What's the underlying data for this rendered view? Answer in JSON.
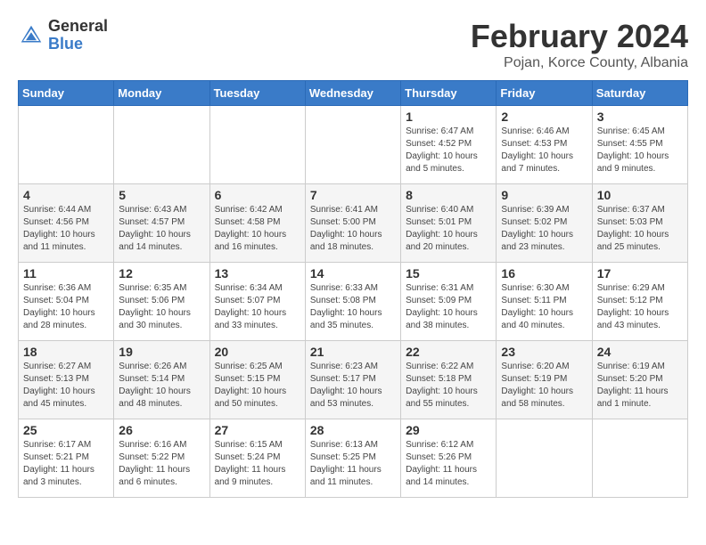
{
  "header": {
    "logo_general": "General",
    "logo_blue": "Blue",
    "title": "February 2024",
    "subtitle": "Pojan, Korce County, Albania"
  },
  "days_of_week": [
    "Sunday",
    "Monday",
    "Tuesday",
    "Wednesday",
    "Thursday",
    "Friday",
    "Saturday"
  ],
  "weeks": [
    [
      {
        "day": "",
        "info": ""
      },
      {
        "day": "",
        "info": ""
      },
      {
        "day": "",
        "info": ""
      },
      {
        "day": "",
        "info": ""
      },
      {
        "day": "1",
        "info": "Sunrise: 6:47 AM\nSunset: 4:52 PM\nDaylight: 10 hours\nand 5 minutes."
      },
      {
        "day": "2",
        "info": "Sunrise: 6:46 AM\nSunset: 4:53 PM\nDaylight: 10 hours\nand 7 minutes."
      },
      {
        "day": "3",
        "info": "Sunrise: 6:45 AM\nSunset: 4:55 PM\nDaylight: 10 hours\nand 9 minutes."
      }
    ],
    [
      {
        "day": "4",
        "info": "Sunrise: 6:44 AM\nSunset: 4:56 PM\nDaylight: 10 hours\nand 11 minutes."
      },
      {
        "day": "5",
        "info": "Sunrise: 6:43 AM\nSunset: 4:57 PM\nDaylight: 10 hours\nand 14 minutes."
      },
      {
        "day": "6",
        "info": "Sunrise: 6:42 AM\nSunset: 4:58 PM\nDaylight: 10 hours\nand 16 minutes."
      },
      {
        "day": "7",
        "info": "Sunrise: 6:41 AM\nSunset: 5:00 PM\nDaylight: 10 hours\nand 18 minutes."
      },
      {
        "day": "8",
        "info": "Sunrise: 6:40 AM\nSunset: 5:01 PM\nDaylight: 10 hours\nand 20 minutes."
      },
      {
        "day": "9",
        "info": "Sunrise: 6:39 AM\nSunset: 5:02 PM\nDaylight: 10 hours\nand 23 minutes."
      },
      {
        "day": "10",
        "info": "Sunrise: 6:37 AM\nSunset: 5:03 PM\nDaylight: 10 hours\nand 25 minutes."
      }
    ],
    [
      {
        "day": "11",
        "info": "Sunrise: 6:36 AM\nSunset: 5:04 PM\nDaylight: 10 hours\nand 28 minutes."
      },
      {
        "day": "12",
        "info": "Sunrise: 6:35 AM\nSunset: 5:06 PM\nDaylight: 10 hours\nand 30 minutes."
      },
      {
        "day": "13",
        "info": "Sunrise: 6:34 AM\nSunset: 5:07 PM\nDaylight: 10 hours\nand 33 minutes."
      },
      {
        "day": "14",
        "info": "Sunrise: 6:33 AM\nSunset: 5:08 PM\nDaylight: 10 hours\nand 35 minutes."
      },
      {
        "day": "15",
        "info": "Sunrise: 6:31 AM\nSunset: 5:09 PM\nDaylight: 10 hours\nand 38 minutes."
      },
      {
        "day": "16",
        "info": "Sunrise: 6:30 AM\nSunset: 5:11 PM\nDaylight: 10 hours\nand 40 minutes."
      },
      {
        "day": "17",
        "info": "Sunrise: 6:29 AM\nSunset: 5:12 PM\nDaylight: 10 hours\nand 43 minutes."
      }
    ],
    [
      {
        "day": "18",
        "info": "Sunrise: 6:27 AM\nSunset: 5:13 PM\nDaylight: 10 hours\nand 45 minutes."
      },
      {
        "day": "19",
        "info": "Sunrise: 6:26 AM\nSunset: 5:14 PM\nDaylight: 10 hours\nand 48 minutes."
      },
      {
        "day": "20",
        "info": "Sunrise: 6:25 AM\nSunset: 5:15 PM\nDaylight: 10 hours\nand 50 minutes."
      },
      {
        "day": "21",
        "info": "Sunrise: 6:23 AM\nSunset: 5:17 PM\nDaylight: 10 hours\nand 53 minutes."
      },
      {
        "day": "22",
        "info": "Sunrise: 6:22 AM\nSunset: 5:18 PM\nDaylight: 10 hours\nand 55 minutes."
      },
      {
        "day": "23",
        "info": "Sunrise: 6:20 AM\nSunset: 5:19 PM\nDaylight: 10 hours\nand 58 minutes."
      },
      {
        "day": "24",
        "info": "Sunrise: 6:19 AM\nSunset: 5:20 PM\nDaylight: 11 hours\nand 1 minute."
      }
    ],
    [
      {
        "day": "25",
        "info": "Sunrise: 6:17 AM\nSunset: 5:21 PM\nDaylight: 11 hours\nand 3 minutes."
      },
      {
        "day": "26",
        "info": "Sunrise: 6:16 AM\nSunset: 5:22 PM\nDaylight: 11 hours\nand 6 minutes."
      },
      {
        "day": "27",
        "info": "Sunrise: 6:15 AM\nSunset: 5:24 PM\nDaylight: 11 hours\nand 9 minutes."
      },
      {
        "day": "28",
        "info": "Sunrise: 6:13 AM\nSunset: 5:25 PM\nDaylight: 11 hours\nand 11 minutes."
      },
      {
        "day": "29",
        "info": "Sunrise: 6:12 AM\nSunset: 5:26 PM\nDaylight: 11 hours\nand 14 minutes."
      },
      {
        "day": "",
        "info": ""
      },
      {
        "day": "",
        "info": ""
      }
    ]
  ]
}
